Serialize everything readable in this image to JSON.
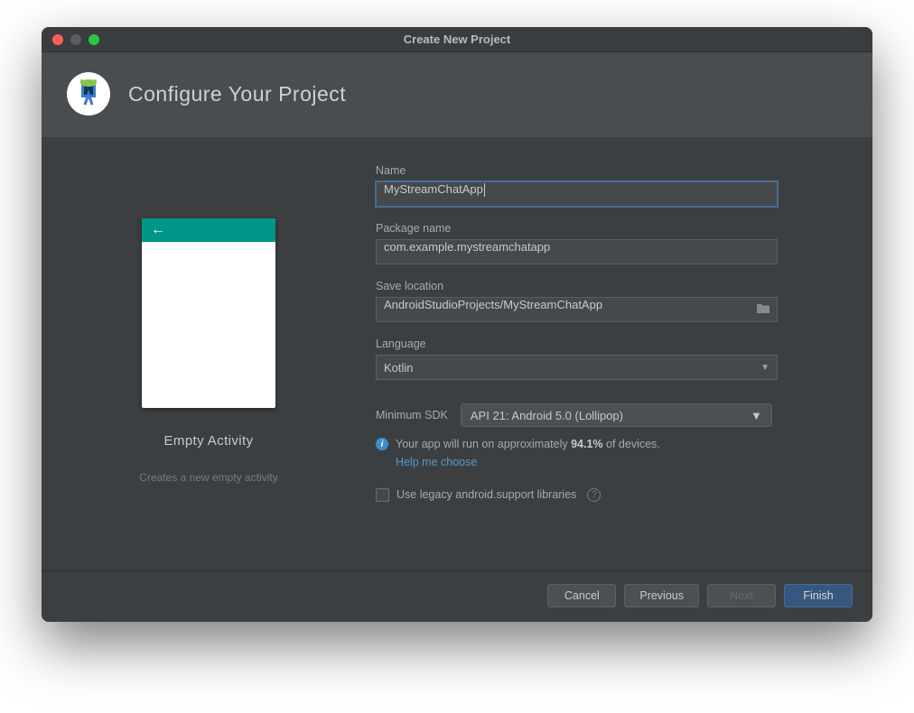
{
  "window": {
    "title": "Create New Project"
  },
  "header": {
    "title": "Configure Your Project"
  },
  "preview": {
    "title": "Empty Activity",
    "description": "Creates a new empty activity"
  },
  "form": {
    "name_label": "Name",
    "name_value": "MyStreamChatApp",
    "package_label": "Package name",
    "package_value": "com.example.mystreamchatapp",
    "save_label": "Save location",
    "save_value": "AndroidStudioProjects/MyStreamChatApp",
    "language_label": "Language",
    "language_value": "Kotlin",
    "sdk_label": "Minimum SDK",
    "sdk_value": "API 21: Android 5.0 (Lollipop)",
    "info_prefix": "Your app will run on approximately ",
    "info_pct": "94.1%",
    "info_suffix": " of devices.",
    "help_link": "Help me choose",
    "legacy_label": "Use legacy android.support libraries"
  },
  "footer": {
    "cancel": "Cancel",
    "previous": "Previous",
    "next": "Next",
    "finish": "Finish"
  }
}
